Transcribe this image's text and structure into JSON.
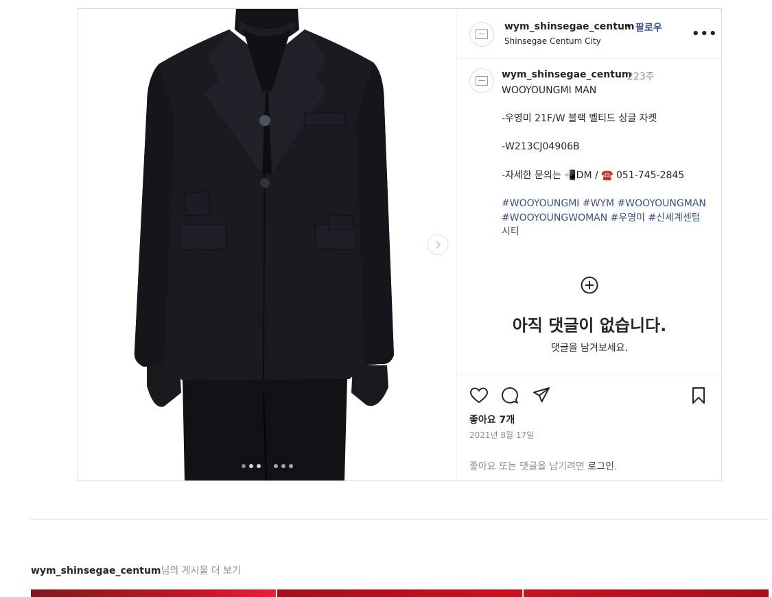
{
  "post": {
    "username": "wym_shinsegae_centum",
    "separator": "•",
    "follow_label": "팔로우",
    "location": "Shinsegae Centum City",
    "more_label": "•••",
    "caption": {
      "username": "wym_shinsegae_centum",
      "time": "223주",
      "text": "WOOYOUNGMI MAN\n\n-우영미 21F/W 블랙 벨티드 싱글 자켓\n\n-W213CJ04906B\n\n-자세한 문의는 📲DM / ☎️ 051-745-2845",
      "hashtags": "#WOOYOUNGMI #WYM #WOOYOUNGMAN #WOOYOUNGWOMAN #우영미 #신세계센텀시티"
    },
    "no_comments_title": "아직 댓글이 없습니다.",
    "no_comments_sub": "댓글을 남겨보세요.",
    "likes": "좋아요 7개",
    "date": "2021년 8월 17일",
    "login_prompt_prefix": "좋아요 또는 댓글을 남기려면 ",
    "login_link": "로그인",
    "login_prompt_suffix": ".",
    "carousel": {
      "count": 6,
      "active_index": 0
    }
  },
  "more_posts": {
    "username": "wym_shinsegae_centum",
    "suffix": "님의 게시물 더 보기"
  },
  "colors": {
    "link": "#385185",
    "muted": "#8e8e8e",
    "border": "#dbdbdb",
    "thumb_red": "#b3121f"
  },
  "icons": [
    "heart-icon",
    "comment-icon",
    "share-icon",
    "bookmark-icon",
    "add-comment-icon",
    "chevron-right-icon",
    "more-icon"
  ]
}
